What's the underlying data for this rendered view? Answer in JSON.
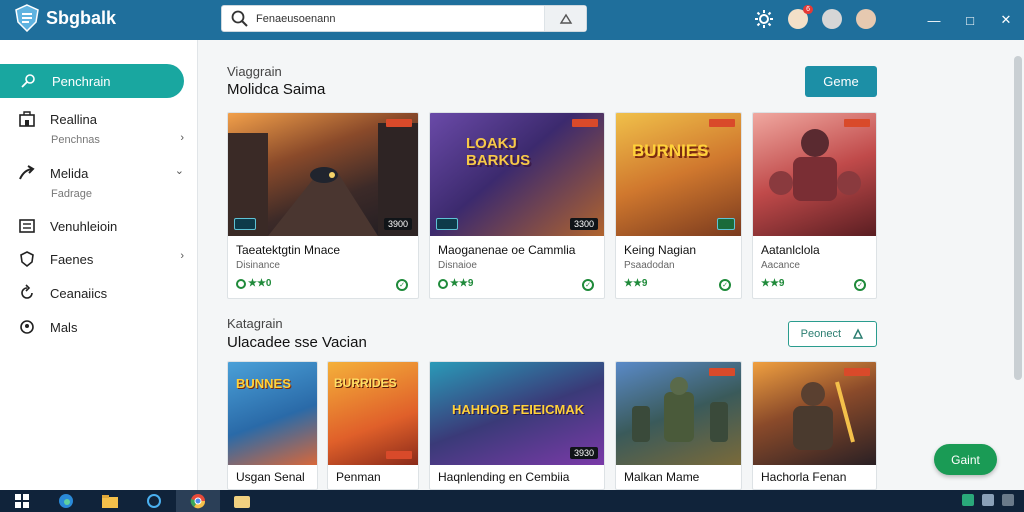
{
  "app": {
    "brand": "Sbgbalk"
  },
  "search": {
    "value": "Fenaeusoenann"
  },
  "header": {
    "notification_count": "6"
  },
  "sidebar": {
    "active": {
      "label": "Penchrain"
    },
    "items": [
      {
        "label": "Reallina",
        "sub": "Penchnas"
      },
      {
        "label": "Melida",
        "sub": "Fadrage"
      },
      {
        "label": "Venuhleioin"
      },
      {
        "label": "Faenes"
      },
      {
        "label": "Ceanaiics"
      },
      {
        "label": "Mals"
      }
    ]
  },
  "section1": {
    "subtitle": "Viaggrain",
    "title": "Molidca Saima",
    "button": "Geme"
  },
  "section2": {
    "subtitle": "Katagrain",
    "title": "Ulacadee sse Vacian",
    "button": "Peonect"
  },
  "cards_row1": [
    {
      "title": "Taeatektgtin Mnace",
      "sub": "Disinance",
      "rating": "★★0",
      "num": "3900"
    },
    {
      "title": "Maoganenae oe Cammlia",
      "sub": "Disnaioe",
      "rating": "★★9",
      "num": "3300",
      "art": "LOAKJ BARKUS"
    },
    {
      "title": "Keing Nagian",
      "sub": "Psaadodan",
      "rating": "★★9",
      "art": "BURNIES"
    },
    {
      "title": "Aatanlclola",
      "sub": "Aacance",
      "rating": "★★9"
    }
  ],
  "cards_row2": [
    {
      "title": "Usgan Senal",
      "art": "BUNNES"
    },
    {
      "title": "Penman",
      "art": "BURRIDES"
    },
    {
      "title": "Haqnlending en Cembiia",
      "num": "3930",
      "art": "HAHHOB FEIEICMAK"
    },
    {
      "title": "Malkan Mame"
    },
    {
      "title": "Hachorla Fenan"
    }
  ],
  "fab": {
    "label": "Gaint"
  },
  "colors": {
    "header": "#1f6f9c",
    "accent": "#19a7a0",
    "primary": "#1c8fa6",
    "fab": "#1a9b55"
  }
}
